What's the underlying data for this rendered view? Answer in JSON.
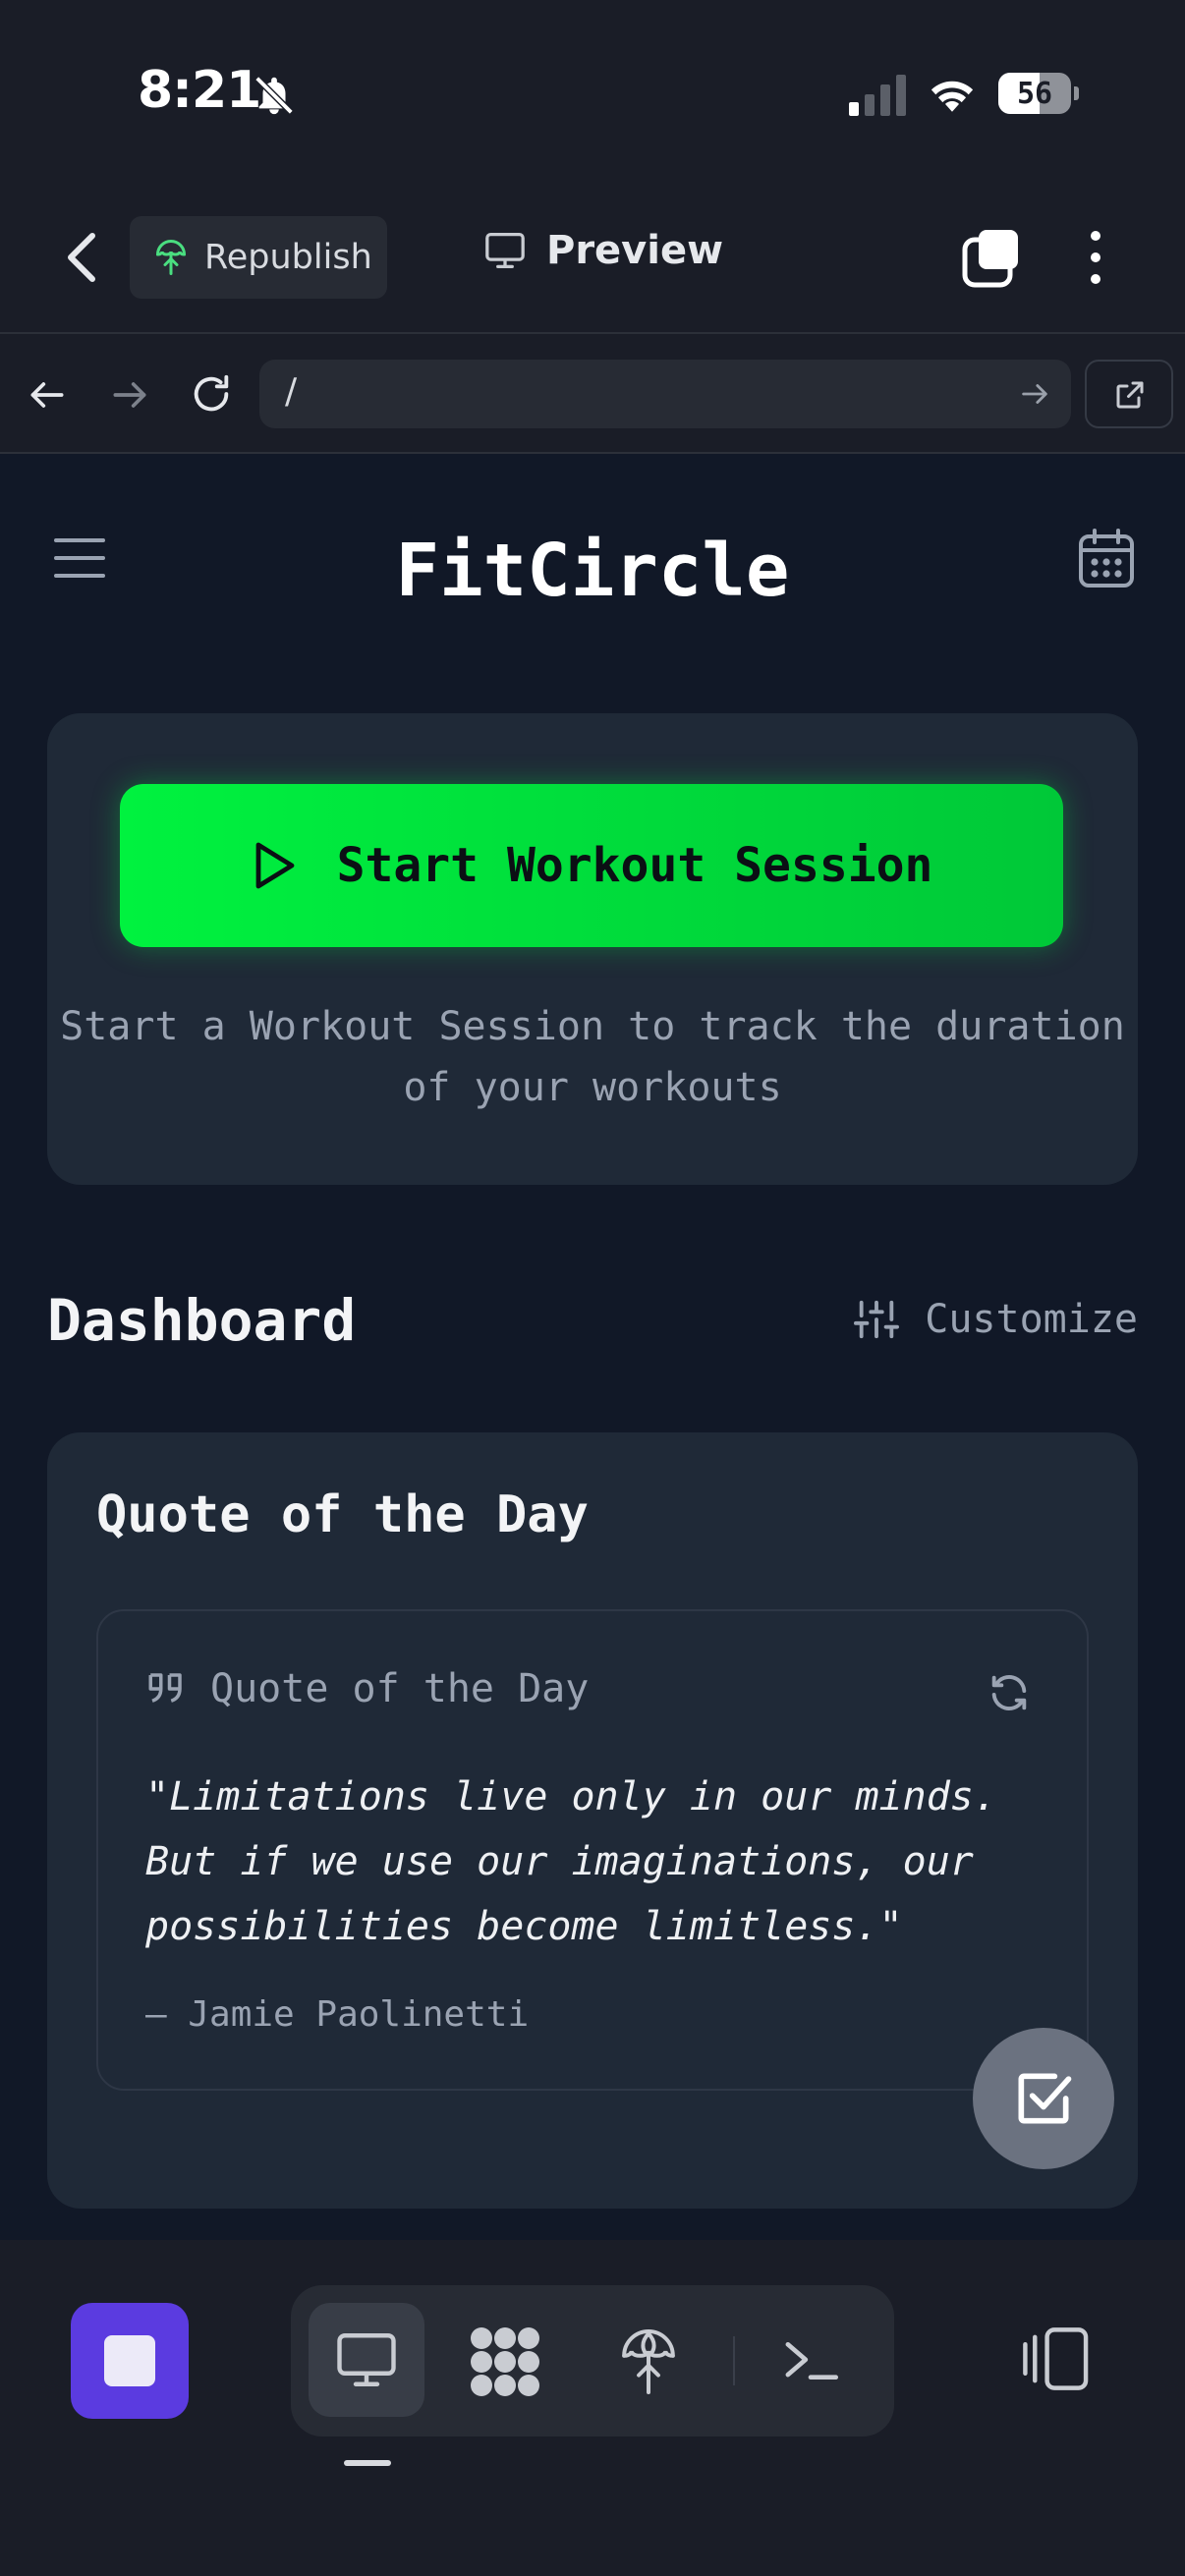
{
  "status_bar": {
    "time": "8:21",
    "battery": "56",
    "icons": [
      "bell-slash-icon",
      "cellular-signal-icon",
      "wifi-icon",
      "battery-icon"
    ]
  },
  "app_toolbar": {
    "back_icon": "chevron-left-icon",
    "republish_label": "Republish",
    "preview_label": "Preview",
    "tabs_icon": "tabs-icon",
    "more_icon": "more-vertical-icon"
  },
  "browser_bar": {
    "url": "/",
    "icons": [
      "arrow-left-icon",
      "arrow-right-icon",
      "reload-icon",
      "go-arrow-icon",
      "external-link-icon"
    ]
  },
  "app": {
    "title": "FitCircle",
    "start_button_label": "Start Workout Session",
    "start_description": "Start a Workout Session to track the duration of your workouts",
    "dashboard_title": "Dashboard",
    "customize_label": "Customize",
    "quote_card": {
      "title": "Quote of the Day",
      "header_label": "Quote of the Day",
      "quote": "\"Limitations live only in our minds. But if we use our imaginations, our possibilities become limitless.\"",
      "author": "— Jamie Paolinetti"
    }
  },
  "colors": {
    "accent_green": "#00e63c",
    "stop_purple": "#5b3be0",
    "background": "#111827",
    "card": "#1f2937"
  }
}
